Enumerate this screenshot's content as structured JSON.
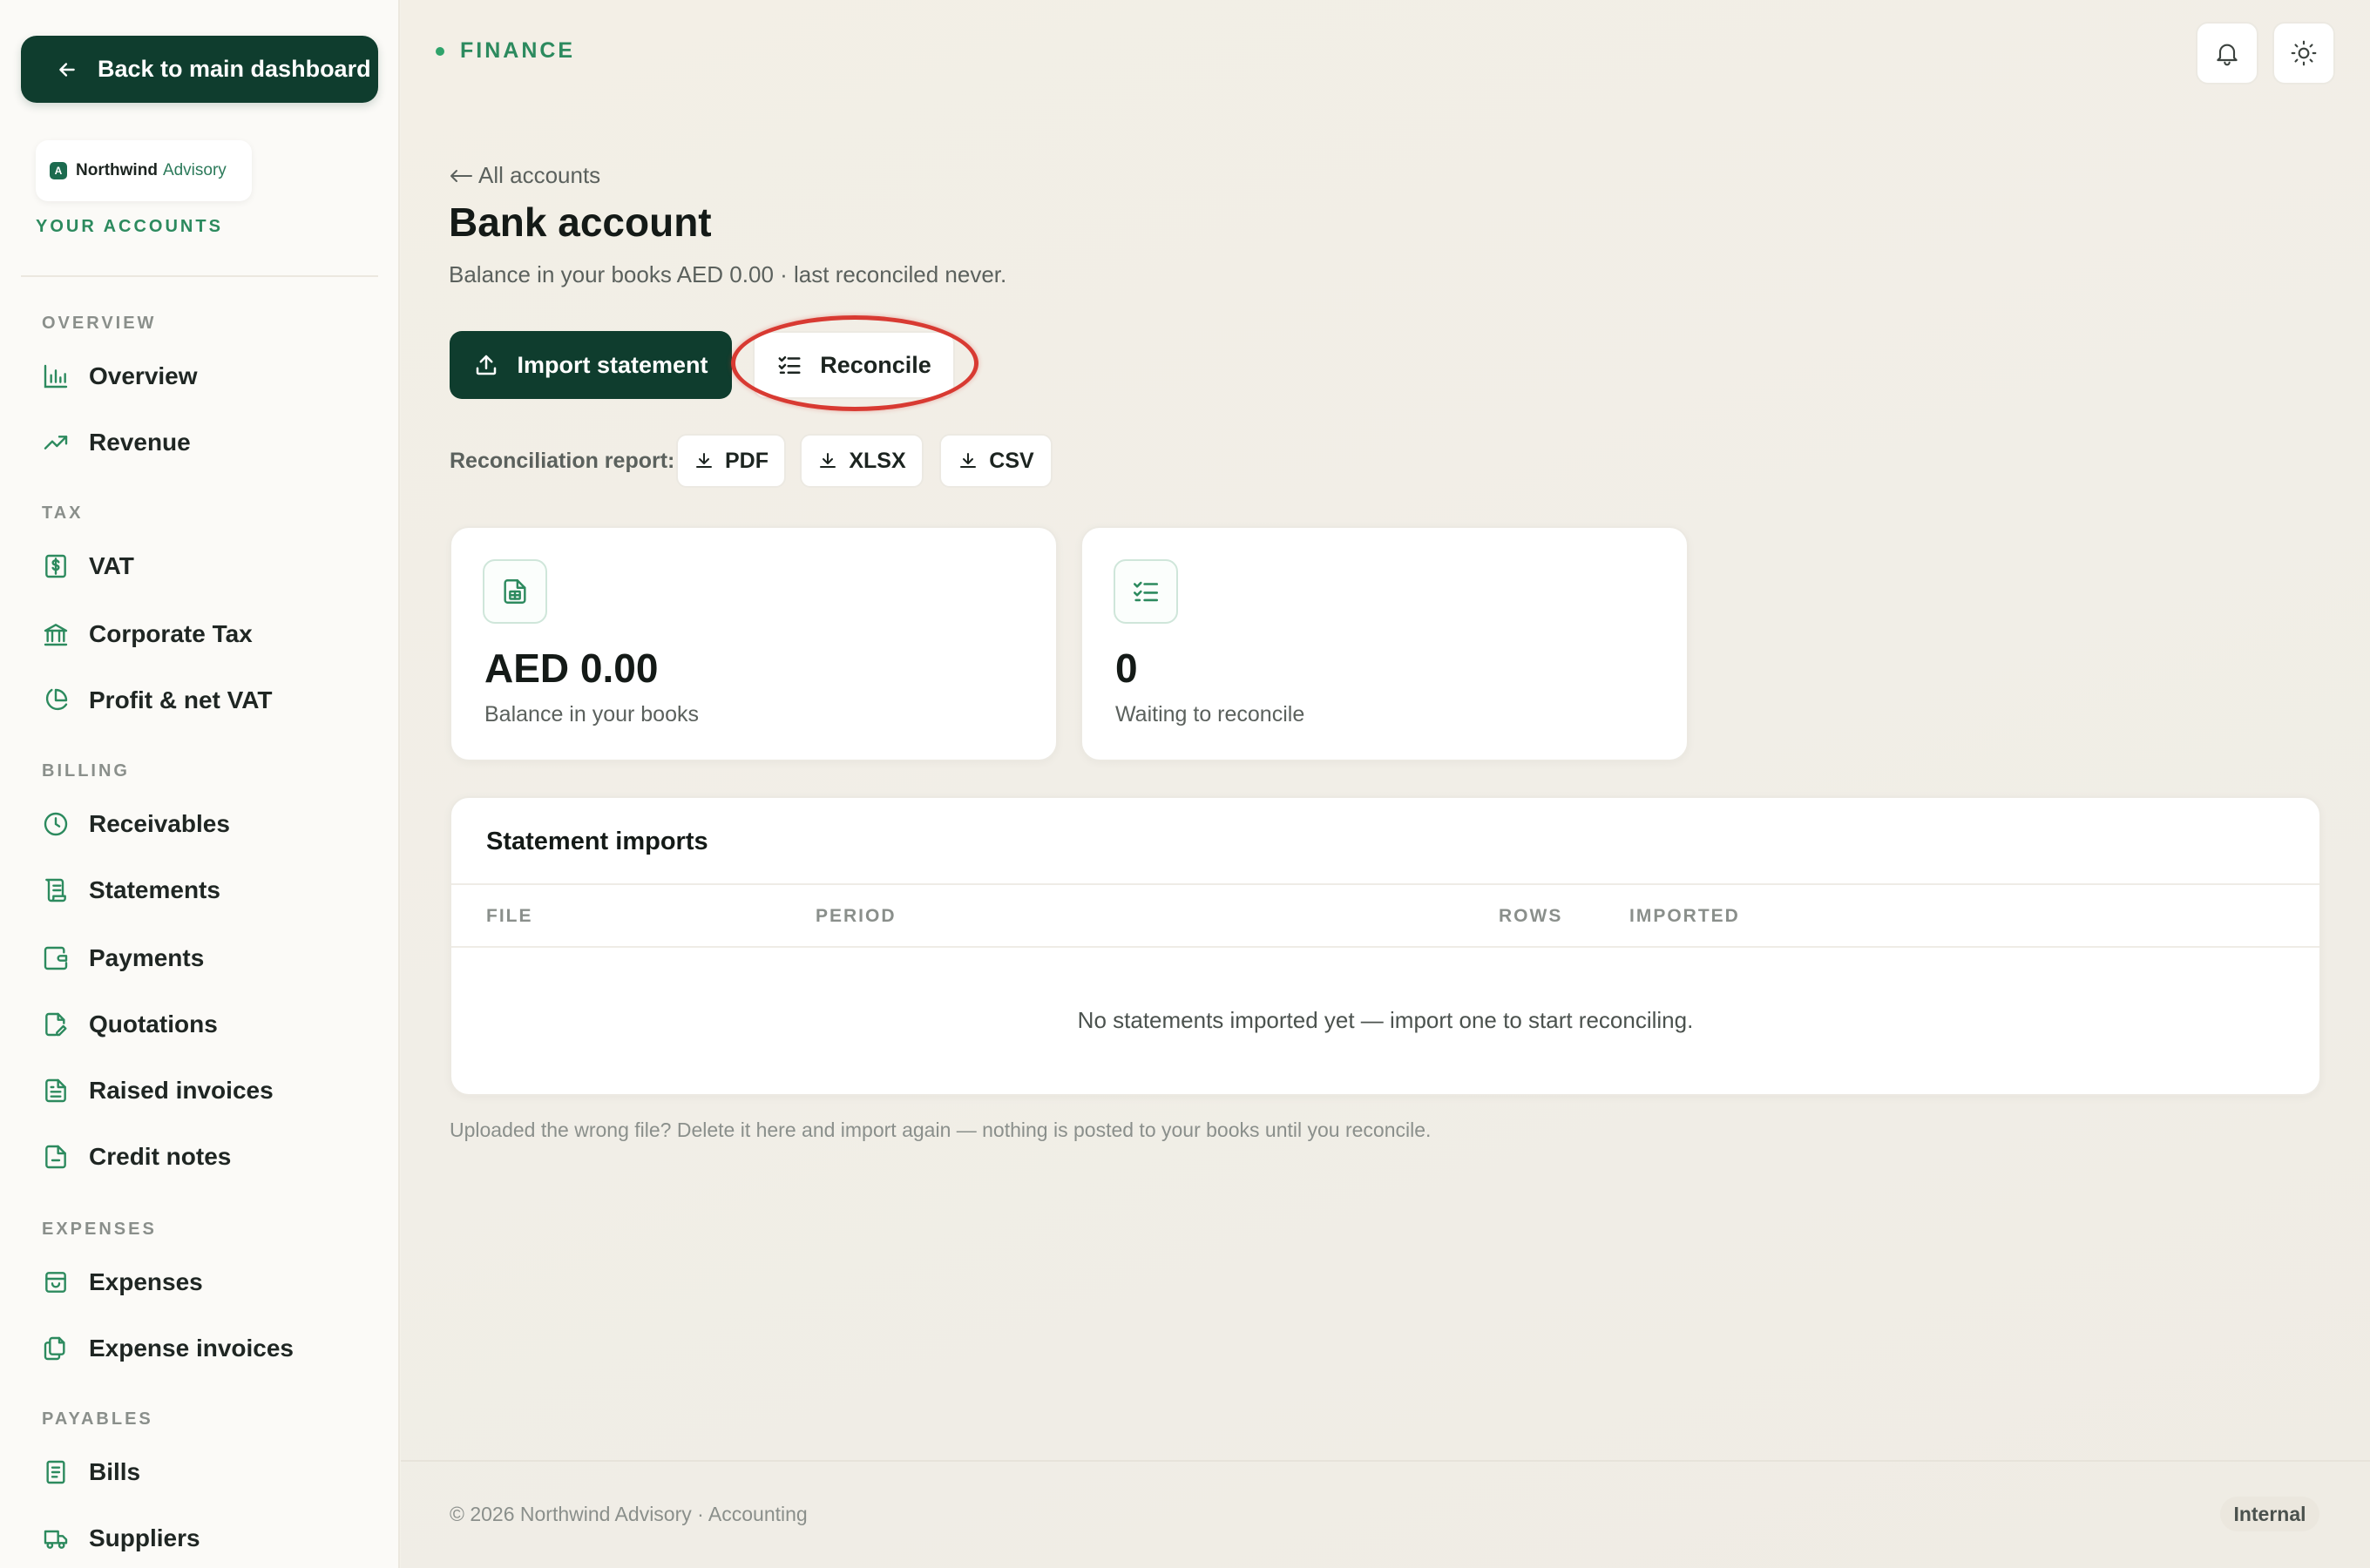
{
  "sidebar": {
    "back_label": "Back to main dashboard",
    "brand": {
      "logo_letter": "A",
      "name": "Northwind",
      "sub": "Advisory"
    },
    "your_accounts": "YOUR ACCOUNTS",
    "sections": [
      {
        "title": "OVERVIEW",
        "items": [
          {
            "label": "Overview",
            "icon": "bar-chart-icon"
          },
          {
            "label": "Revenue",
            "icon": "trend-up-icon"
          }
        ]
      },
      {
        "title": "TAX",
        "items": [
          {
            "label": "VAT",
            "icon": "dollar-doc-icon"
          },
          {
            "label": "Corporate Tax",
            "icon": "bank-icon"
          },
          {
            "label": "Profit & net VAT",
            "icon": "pie-chart-icon"
          }
        ]
      },
      {
        "title": "BILLING",
        "items": [
          {
            "label": "Receivables",
            "icon": "clock-icon"
          },
          {
            "label": "Statements",
            "icon": "scroll-icon"
          },
          {
            "label": "Payments",
            "icon": "wallet-icon"
          },
          {
            "label": "Quotations",
            "icon": "edit-doc-icon"
          },
          {
            "label": "Raised invoices",
            "icon": "invoice-icon"
          },
          {
            "label": "Credit notes",
            "icon": "file-icon"
          }
        ]
      },
      {
        "title": "EXPENSES",
        "items": [
          {
            "label": "Expenses",
            "icon": "bag-icon"
          },
          {
            "label": "Expense invoices",
            "icon": "files-icon"
          }
        ]
      },
      {
        "title": "PAYABLES",
        "items": [
          {
            "label": "Bills",
            "icon": "receipt-icon"
          },
          {
            "label": "Suppliers",
            "icon": "truck-icon"
          }
        ]
      }
    ]
  },
  "header": {
    "section": "FINANCE",
    "notifications_icon": "bell-icon",
    "theme_icon": "sun-icon"
  },
  "page": {
    "back_link": "All accounts",
    "title": "Bank account",
    "subtitle": "Balance in your books AED 0.00 · last reconciled never.",
    "import_label": "Import statement",
    "reconcile_label": "Reconcile",
    "report_label": "Reconciliation report:",
    "downloads": [
      "PDF",
      "XLSX",
      "CSV"
    ]
  },
  "stats": [
    {
      "value": "AED 0.00",
      "label": "Balance in your books",
      "icon": "document-icon"
    },
    {
      "value": "0",
      "label": "Waiting to reconcile",
      "icon": "checklist-icon"
    }
  ],
  "imports_table": {
    "title": "Statement imports",
    "columns": [
      "FILE",
      "PERIOD",
      "ROWS",
      "IMPORTED"
    ],
    "empty_message": "No statements imported yet — import one to start reconciling."
  },
  "hint": "Uploaded the wrong file? Delete it here and import again — nothing is posted to your books until you reconcile.",
  "footer": {
    "copyright": "© 2026 Northwind Advisory · Accounting",
    "badge": "Internal"
  },
  "colors": {
    "brand_dark": "#0f3d2e",
    "accent_green": "#2c8a5e",
    "highlight_red": "#d83a32"
  }
}
